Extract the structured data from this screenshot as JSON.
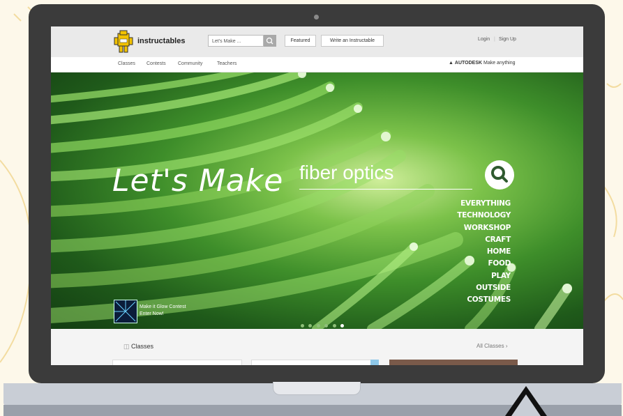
{
  "header": {
    "logo_text": "instructables",
    "search_placeholder": "Let's Make ...",
    "featured_label": "Featured",
    "write_label": "Write an Instructable",
    "login_label": "Login",
    "signup_label": "Sign Up"
  },
  "nav": {
    "items": [
      "Classes",
      "Contests",
      "Community",
      "Teachers"
    ],
    "autodesk_label": "AUTODESK",
    "autodesk_suffix": "Make anything"
  },
  "hero": {
    "lets_make": "Let's Make",
    "search_value": "fiber optics",
    "categories": [
      "EVERYTHING",
      "TECHNOLOGY",
      "WORKSHOP",
      "CRAFT",
      "HOME",
      "FOOD",
      "PLAY",
      "OUTSIDE",
      "COSTUMES"
    ],
    "promo_line1": "Make it Glow Contest",
    "promo_line2": "Enter Now!",
    "carousel_dots": 6,
    "active_dot": 5
  },
  "classes": {
    "title": "Classes",
    "all_link": "All Classes"
  },
  "colors": {
    "laptop_frame": "#3b3b3b",
    "hero_green": "#3e8e2a",
    "accent_yellow": "#f2c200"
  }
}
